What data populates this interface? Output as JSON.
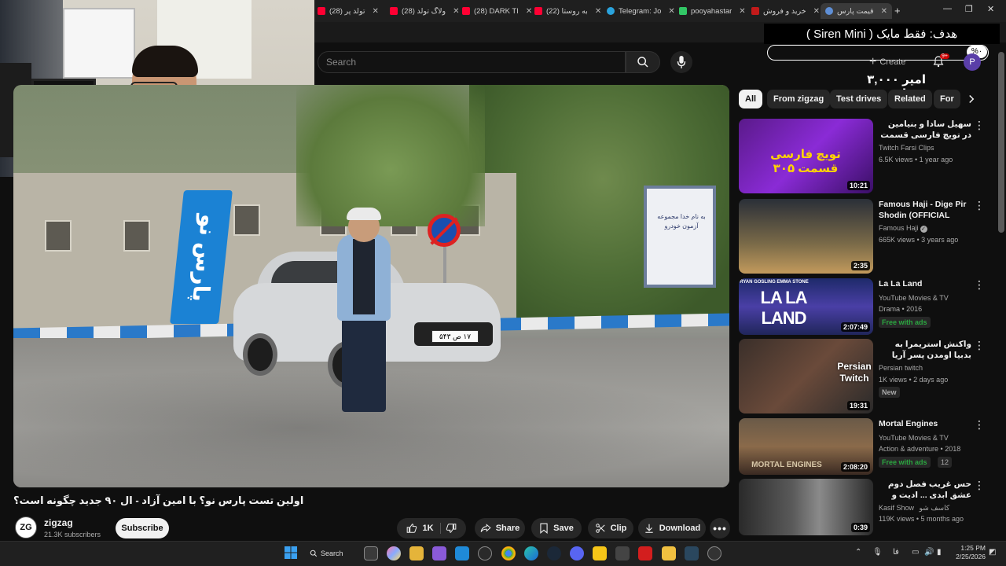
{
  "browser": {
    "tabs": [
      {
        "title": "(28) تولد پر",
        "color": "#ff0033"
      },
      {
        "title": "(28) ولاگ تولد",
        "color": "#ff0033"
      },
      {
        "title": "(28) DARK TI",
        "color": "#ff0033"
      },
      {
        "title": "(22) به روستا",
        "color": "#ff0033"
      },
      {
        "title": "Telegram: Jo",
        "color": "#2aa3dd"
      },
      {
        "title": "pooyahastar",
        "color": "#32c766"
      },
      {
        "title": "خرید و فروش",
        "color": "#c21a1a"
      },
      {
        "title": "قیمت پارس",
        "color": "#5f8fd6"
      }
    ],
    "new_tab": "+",
    "controls": {
      "minimize": "—",
      "restore": "❐",
      "close": "✕"
    }
  },
  "overlay": {
    "goal": "هدف: فقط مایک ( Siren Mini )",
    "price": "امیر ۳,۰۰۰ تومان",
    "percent": "%٠"
  },
  "header": {
    "search_placeholder": "Search",
    "create_label": "Create",
    "notif_count": "9+",
    "avatar_letter": "P"
  },
  "video": {
    "title": "اولین تست پارس نو؟ با امین آزاد - ال ۹۰ جدید چگونه است؟",
    "banner_text": "پارس نو",
    "plate_text": "۱۷ ص ۵۴۳",
    "board_text": "به نام خدا مجموعه آزمون خودرو",
    "channel": {
      "name": "zigzag",
      "subscribers": "21.3K subscribers",
      "avatar_text": "ZG"
    },
    "subscribe_label": "Subscribe",
    "actions": {
      "likes": "1K",
      "share": "Share",
      "save": "Save",
      "clip": "Clip",
      "download": "Download"
    }
  },
  "chips": [
    "All",
    "From zigzag",
    "Test drives",
    "Related",
    "For"
  ],
  "recommendations": [
    {
      "title": "سهیل سادا و بنیامین در تویچ فارسی قسمت 305 👏",
      "channel": "Twitch Farsi Clips",
      "meta": "6.5K views • 1 year ago",
      "duration": "10:21",
      "thumb_text": "تویچ فارسی قسمت ۳۰۵",
      "rtl": true
    },
    {
      "title": "Famous Haji - Dige Pir Shodin (OFFICIAL VIDE...",
      "channel": "Famous Haji",
      "verified": true,
      "meta": "665K views • 3 years ago",
      "duration": "2:35",
      "rtl": false
    },
    {
      "title": "La La Land",
      "channel": "YouTube Movies & TV",
      "meta": "Drama • 2016",
      "badge": "Free with ads",
      "duration": "2:07:49",
      "thumb_text": "LA LA LAND",
      "thumb_caption": "RYAN GOSLING   EMMA STONE",
      "rtl": false
    },
    {
      "title": "واکنش استریمرا به بدبیا اومدن پسر آریا کوکبی ❌دعوای ذاموسی ...",
      "channel": "Persian twitch",
      "meta": "1K views • 2 days ago",
      "badge": "New",
      "duration": "19:31",
      "thumb_text": "Persian Twitch",
      "rtl": true
    },
    {
      "title": "Mortal Engines",
      "channel": "YouTube Movies & TV",
      "meta": "Action & adventure • 2018",
      "badge": "Free with ads",
      "count": "12",
      "duration": "2:08:20",
      "thumb_text": "MORTAL ENGINES",
      "rtl": false
    },
    {
      "title": "حس غریب فصل دوم عشق ابدی ... ادیت و تحلیل #عشق_ابدی",
      "channel": "Kasif Show",
      "channel_extra": "کاسف شو",
      "meta": "119K views • 5 months ago",
      "duration": "0:39",
      "rtl": true
    }
  ],
  "taskbar": {
    "search_label": "Search",
    "clock_time": "1:25 PM",
    "clock_date": "2/25/2026",
    "tray_lang": "فا"
  },
  "colors": {
    "accent": "#ff0033",
    "background": "#0f0f0f",
    "chip_bg": "#272727"
  }
}
